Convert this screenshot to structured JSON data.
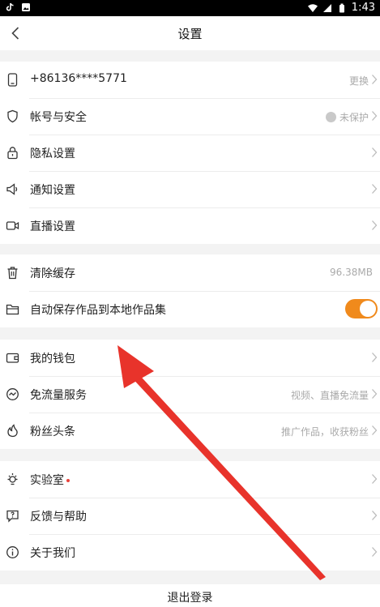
{
  "status_bar": {
    "time": "1:43"
  },
  "header": {
    "title": "设置"
  },
  "groups": [
    {
      "items": [
        {
          "label": "+86136****5771",
          "value": "更换"
        },
        {
          "label": "帐号与安全",
          "value": "未保护"
        },
        {
          "label": "隐私设置"
        },
        {
          "label": "通知设置"
        },
        {
          "label": "直播设置"
        }
      ]
    },
    {
      "items": [
        {
          "label": "清除缓存",
          "value": "96.38MB"
        },
        {
          "label": "自动保存作品到本地作品集",
          "toggle_on": true
        }
      ]
    },
    {
      "items": [
        {
          "label": "我的钱包"
        },
        {
          "label": "免流量服务",
          "value": "视频、直播免流量"
        },
        {
          "label": "粉丝头条",
          "value": "推广作品，收获粉丝"
        }
      ]
    },
    {
      "items": [
        {
          "label": "实验室"
        },
        {
          "label": "反馈与帮助"
        },
        {
          "label": "关于我们"
        }
      ]
    }
  ],
  "logout_label": "退出登录",
  "colors": {
    "accent": "#f08a1c",
    "annotation_arrow": "#e8332b",
    "dot": "#e8413b"
  }
}
